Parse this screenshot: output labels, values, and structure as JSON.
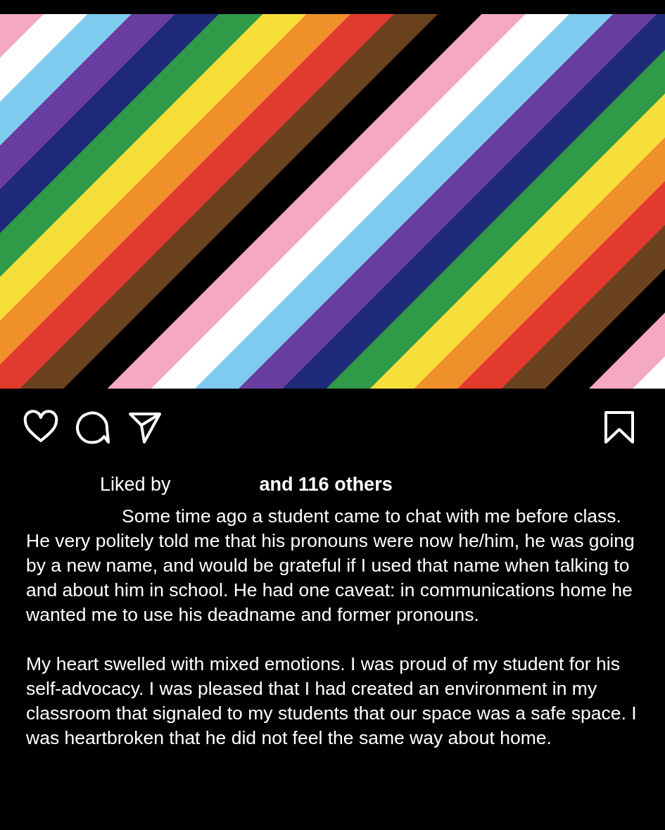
{
  "actions": {
    "liked": false,
    "saved": false
  },
  "likes": {
    "prefix": "Liked by",
    "suffix": "and 116 others"
  },
  "caption": [
    "Some time ago a student came to chat with me before class. He very politely told me that his pronouns were now he/him, he was going by a new name, and would be grateful if I used that name when talking to and about him in school. He had one caveat: in communications home he wanted me to use his deadname and former pronouns.",
    "My heart swelled with mixed emotions. I was proud of my student for his self-advocacy. I was pleased that I had created an environment in my classroom that signaled to my students that our space was a safe space. I was heartbroken that he did not feel the same way about home."
  ]
}
